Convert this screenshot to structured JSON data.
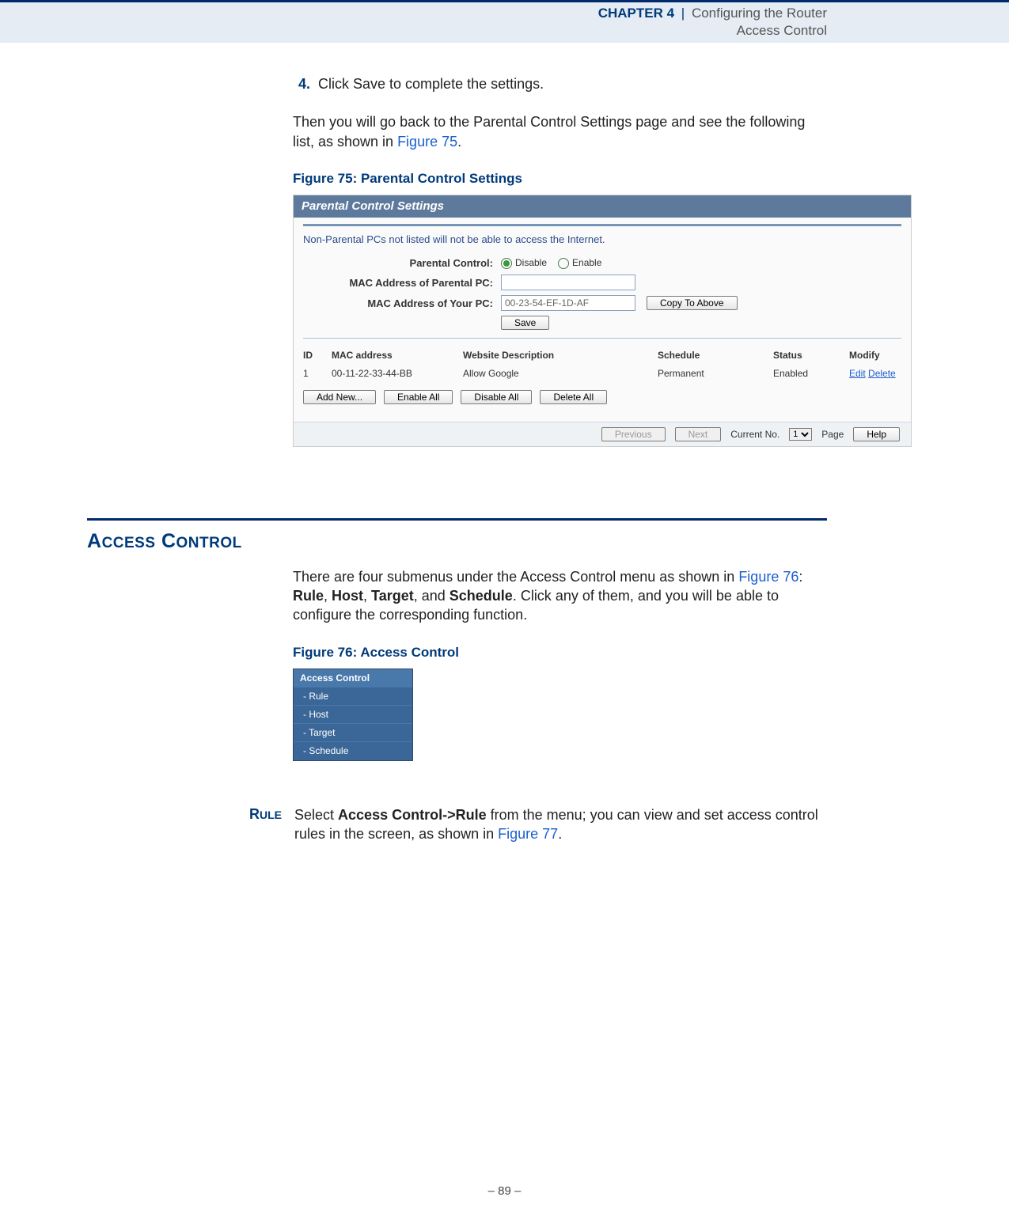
{
  "header": {
    "chapter": "CHAPTER 4",
    "pipe": "|",
    "title": "Configuring the Router",
    "subtitle": "Access Control"
  },
  "step": {
    "num": "4.",
    "text": "Click Save to complete the settings."
  },
  "intro": {
    "text_a": "Then you will go back to the Parental Control Settings page and see the following list, as shown in ",
    "link": "Figure 75",
    "text_b": "."
  },
  "fig75": {
    "caption": "Figure 75:  Parental Control Settings",
    "panel_title": "Parental Control Settings",
    "note": "Non-Parental PCs not listed will not be able to access the Internet.",
    "labels": {
      "pc": "Parental Control:",
      "disable": "Disable",
      "enable": "Enable",
      "mac_parent": "MAC Address of Parental PC:",
      "mac_your": "MAC Address of Your PC:"
    },
    "values": {
      "mac_parent": "",
      "mac_your": "00-23-54-EF-1D-AF"
    },
    "buttons": {
      "copy": "Copy To Above",
      "save": "Save",
      "add": "Add New...",
      "enable_all": "Enable All",
      "disable_all": "Disable All",
      "delete_all": "Delete All",
      "previous": "Previous",
      "next": "Next",
      "help": "Help"
    },
    "table": {
      "head": {
        "id": "ID",
        "mac": "MAC address",
        "desc": "Website Description",
        "sched": "Schedule",
        "status": "Status",
        "modify": "Modify"
      },
      "row": {
        "id": "1",
        "mac": "00-11-22-33-44-BB",
        "desc": "Allow Google",
        "sched": "Permanent",
        "status": "Enabled",
        "edit": "Edit",
        "delete": "Delete"
      }
    },
    "paging": {
      "current": "Current No.",
      "page": "Page",
      "select": "1"
    }
  },
  "section": {
    "title_pre": "A",
    "title_sc": "CCESS",
    "title_sp": " C",
    "title_sc2": "ONTROL",
    "body_a": "There are four submenus under the Access Control menu as shown in ",
    "body_link": "Figure 76",
    "body_b": ": ",
    "b1": "Rule",
    "c1": ", ",
    "b2": "Host",
    "c2": ", ",
    "b3": "Target",
    "c3": ", and ",
    "b4": "Schedule",
    "body_c": ". Click any of them, and you will be able to configure the corresponding function."
  },
  "fig76": {
    "caption": "Figure 76:  Access Control",
    "head": "Access Control",
    "items": [
      "- Rule",
      "- Host",
      "- Target",
      "- Schedule"
    ]
  },
  "rule": {
    "label_pre": "R",
    "label_sc": "ULE",
    "a": "Select ",
    "b": "Access Control->Rule",
    "c": " from the menu; you can view and set access control rules in the screen, as shown in ",
    "link": "Figure 77",
    "d": "."
  },
  "footer": {
    "text": "–  89  –"
  }
}
